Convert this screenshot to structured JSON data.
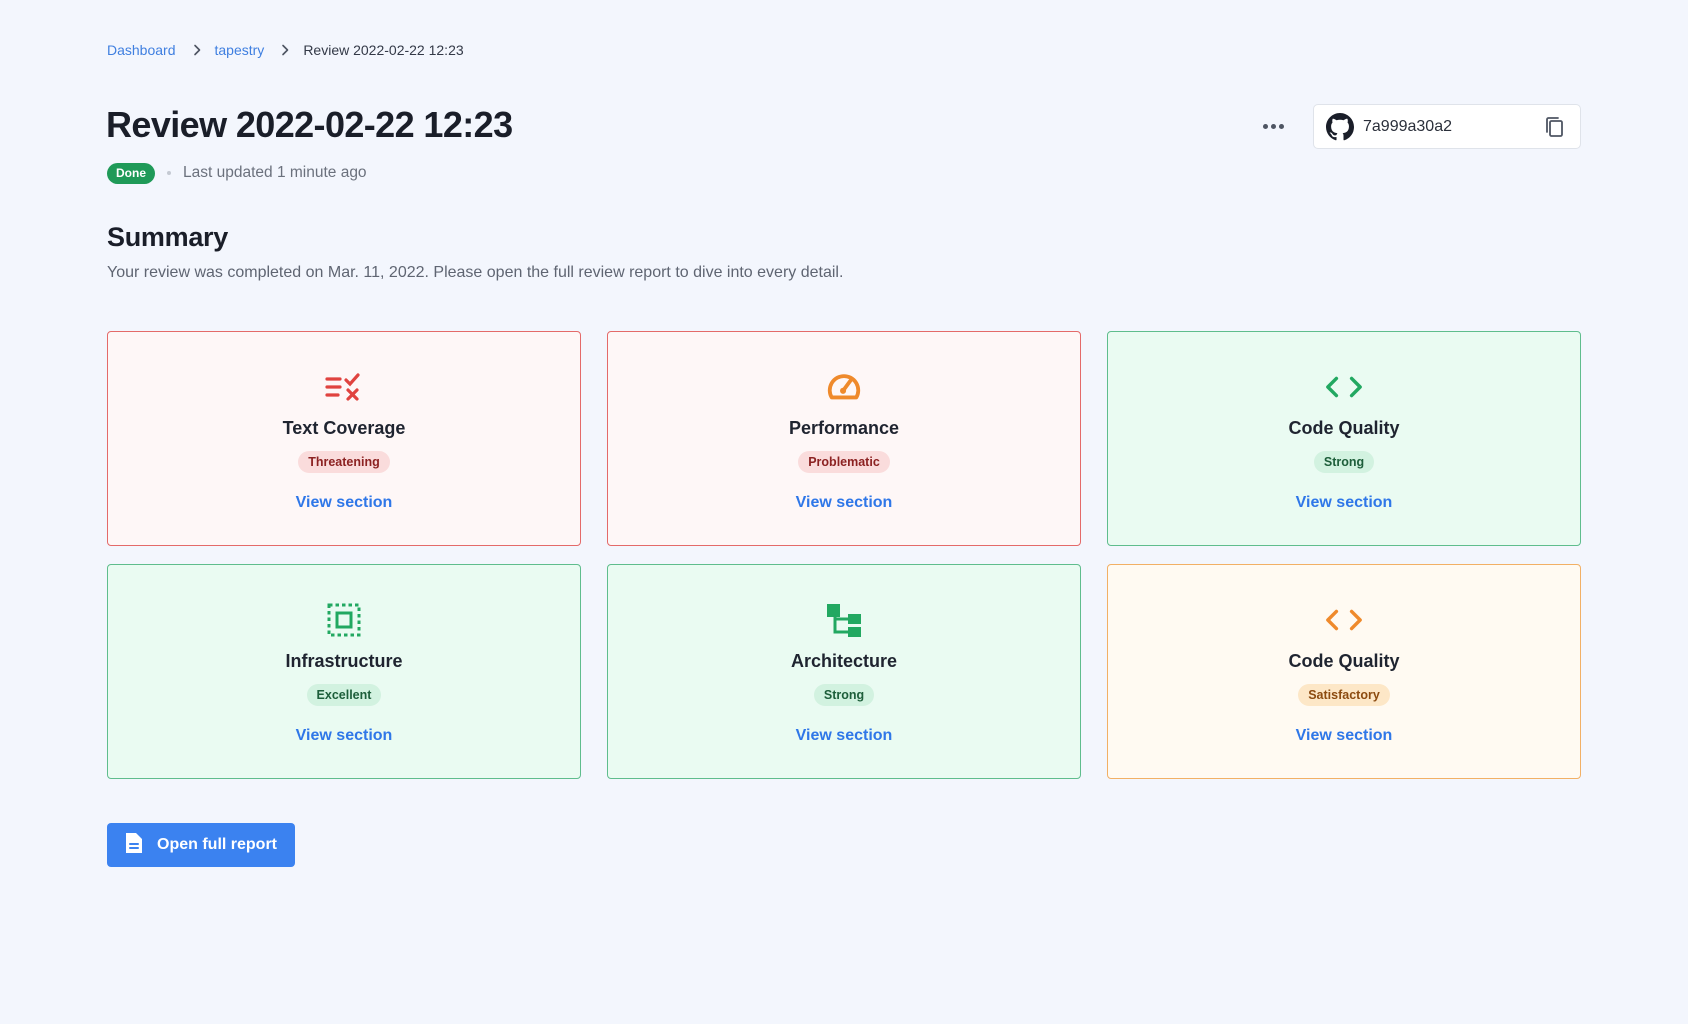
{
  "breadcrumb": {
    "items": [
      "Dashboard",
      "tapestry"
    ],
    "current": "Review 2022-02-22 12:23"
  },
  "header": {
    "title": "Review 2022-02-22 12:23",
    "status": "Done",
    "updated": "Last updated 1 minute ago",
    "commit_hash": "7a999a30a2"
  },
  "summary": {
    "title": "Summary",
    "text": "Your review was completed on Mar. 11, 2022. Please open the full review report to dive into every detail."
  },
  "cards": [
    {
      "title": "Text Coverage",
      "rating": "Threatening",
      "link": "View section",
      "icon": "checklist-icon",
      "tone": "red"
    },
    {
      "title": "Performance",
      "rating": "Problematic",
      "link": "View section",
      "icon": "speedometer-icon",
      "tone": "red"
    },
    {
      "title": "Code Quality",
      "rating": "Strong",
      "link": "View section",
      "icon": "code-icon",
      "tone": "green"
    },
    {
      "title": "Infrastructure",
      "rating": "Excellent",
      "link": "View section",
      "icon": "chip-icon",
      "tone": "green"
    },
    {
      "title": "Architecture",
      "rating": "Strong",
      "link": "View section",
      "icon": "hierarchy-icon",
      "tone": "green"
    },
    {
      "title": "Code Quality",
      "rating": "Satisfactory",
      "link": "View section",
      "icon": "code-icon",
      "tone": "amber"
    }
  ],
  "actions": {
    "open_report": "Open full report"
  },
  "colors": {
    "accent": "#3b82f0",
    "status_done": "#1f9a58",
    "red": "#e46a69",
    "green": "#5fbd8d",
    "amber": "#f2b065"
  }
}
